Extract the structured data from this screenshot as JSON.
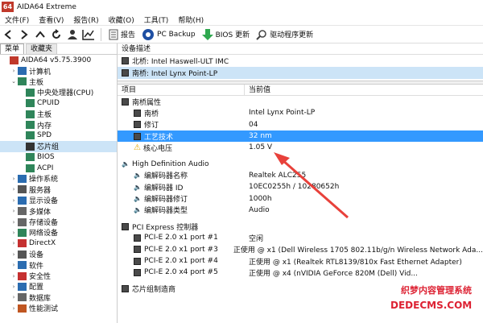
{
  "window": {
    "logo": "64",
    "title": "AIDA64 Extreme"
  },
  "menu": [
    "文件(F)",
    "查看(V)",
    "报告(R)",
    "收藏(O)",
    "工具(T)",
    "帮助(H)"
  ],
  "toolbar": {
    "report": "报告",
    "pcbackup": "PC Backup",
    "bios": "BIOS 更新",
    "driver": "驱动程序更新"
  },
  "tabs": {
    "menu": "菜单",
    "favorites": "收藏夹"
  },
  "tree": [
    {
      "label": "AIDA64 v5.75.3900",
      "indent": 0,
      "chev": "",
      "icon": "#c0392b"
    },
    {
      "label": "计算机",
      "indent": 1,
      "chev": "›",
      "icon": "#2b6cb0"
    },
    {
      "label": "主板",
      "indent": 1,
      "chev": "⌄",
      "icon": "#2f855a"
    },
    {
      "label": "中央处理器(CPU)",
      "indent": 2,
      "chev": "",
      "icon": "#2f855a"
    },
    {
      "label": "CPUID",
      "indent": 2,
      "chev": "",
      "icon": "#2f855a"
    },
    {
      "label": "主板",
      "indent": 2,
      "chev": "",
      "icon": "#2f855a"
    },
    {
      "label": "内存",
      "indent": 2,
      "chev": "",
      "icon": "#2f855a"
    },
    {
      "label": "SPD",
      "indent": 2,
      "chev": "",
      "icon": "#2f855a"
    },
    {
      "label": "芯片组",
      "indent": 2,
      "chev": "",
      "icon": "#333",
      "selected": true
    },
    {
      "label": "BIOS",
      "indent": 2,
      "chev": "",
      "icon": "#2f855a"
    },
    {
      "label": "ACPI",
      "indent": 2,
      "chev": "",
      "icon": "#2f855a"
    },
    {
      "label": "操作系统",
      "indent": 1,
      "chev": "›",
      "icon": "#2b6cb0"
    },
    {
      "label": "服务器",
      "indent": 1,
      "chev": "›",
      "icon": "#555"
    },
    {
      "label": "显示设备",
      "indent": 1,
      "chev": "›",
      "icon": "#2b6cb0"
    },
    {
      "label": "多媒体",
      "indent": 1,
      "chev": "›",
      "icon": "#666"
    },
    {
      "label": "存储设备",
      "indent": 1,
      "chev": "›",
      "icon": "#666"
    },
    {
      "label": "网络设备",
      "indent": 1,
      "chev": "›",
      "icon": "#2f855a"
    },
    {
      "label": "DirectX",
      "indent": 1,
      "chev": "›",
      "icon": "#c53030"
    },
    {
      "label": "设备",
      "indent": 1,
      "chev": "›",
      "icon": "#555"
    },
    {
      "label": "软件",
      "indent": 1,
      "chev": "›",
      "icon": "#2b6cb0"
    },
    {
      "label": "安全性",
      "indent": 1,
      "chev": "›",
      "icon": "#c53030"
    },
    {
      "label": "配置",
      "indent": 1,
      "chev": "›",
      "icon": "#2b6cb0"
    },
    {
      "label": "数据库",
      "indent": 1,
      "chev": "›",
      "icon": "#666"
    },
    {
      "label": "性能测试",
      "indent": 1,
      "chev": "›",
      "icon": "#c05621"
    }
  ],
  "device_desc": {
    "header": "设备描述",
    "items": [
      {
        "label": "北桥: Intel Haswell-ULT IMC",
        "selected": false
      },
      {
        "label": "南桥: Intel Lynx Point-LP",
        "selected": true
      }
    ]
  },
  "table": {
    "col_item": "项目",
    "col_value": "当前值",
    "rows": [
      {
        "type": "group",
        "key": "南桥属性",
        "value": ""
      },
      {
        "type": "item",
        "key": "南桥",
        "value": "Intel Lynx Point-LP"
      },
      {
        "type": "item",
        "key": "修订",
        "value": "04"
      },
      {
        "type": "item",
        "key": "工艺技术",
        "value": "32 nm",
        "highlight": true
      },
      {
        "type": "warn",
        "key": "核心电压",
        "value": "1.05 V"
      },
      {
        "type": "gap"
      },
      {
        "type": "audio",
        "key": "High Definition Audio",
        "value": ""
      },
      {
        "type": "audioitem",
        "key": "编解码器名称",
        "value": "Realtek ALC255"
      },
      {
        "type": "audioitem",
        "key": "编解码器 ID",
        "value": "10EC0255h / 10280652h"
      },
      {
        "type": "audioitem",
        "key": "编解码器修订",
        "value": "1000h"
      },
      {
        "type": "audioitem",
        "key": "编解码器类型",
        "value": "Audio"
      },
      {
        "type": "gap"
      },
      {
        "type": "group",
        "key": "PCI Express 控制器",
        "value": ""
      },
      {
        "type": "item",
        "key": "PCI-E 2.0 x1 port #1",
        "value": "空闲"
      },
      {
        "type": "item",
        "key": "PCI-E 2.0 x1 port #3",
        "value": "正使用 @ x1  (Dell Wireless 1705 802.11b/g/n Wireless Network Ada..."
      },
      {
        "type": "item",
        "key": "PCI-E 2.0 x1 port #4",
        "value": "正使用 @ x1  (Realtek RTL8139/810x Fast Ethernet Adapter)"
      },
      {
        "type": "item",
        "key": "PCI-E 2.0 x4 port #5",
        "value": "正使用 @ x4  (nVIDIA GeForce 820M (Dell) Vid..."
      },
      {
        "type": "gap"
      },
      {
        "type": "group",
        "key": "芯片组制造商",
        "value": ""
      }
    ]
  },
  "watermark": {
    "line1": "织梦内容管理系统",
    "line2": "DEDECMS.COM"
  },
  "colors": {
    "highlight": "#3399ff",
    "selection": "#cce4f7",
    "arrow": "#e8413b"
  }
}
